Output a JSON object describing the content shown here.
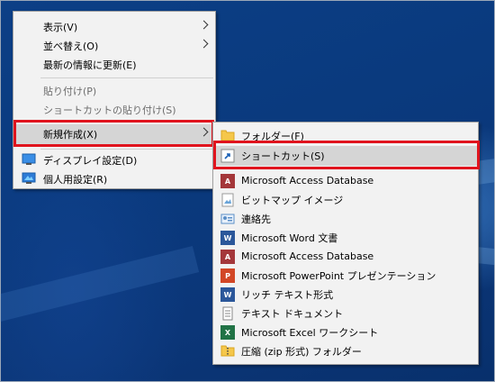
{
  "desktop_menu": {
    "items": [
      {
        "label": "表示(V)",
        "submenu": true,
        "enabled": true
      },
      {
        "label": "並べ替え(O)",
        "submenu": true,
        "enabled": true
      },
      {
        "label": "最新の情報に更新(E)",
        "submenu": false,
        "enabled": true
      },
      {
        "label": "貼り付け(P)",
        "submenu": false,
        "enabled": false
      },
      {
        "label": "ショートカットの貼り付け(S)",
        "submenu": false,
        "enabled": false
      },
      {
        "label": "新規作成(X)",
        "submenu": true,
        "enabled": true,
        "highlighted": true
      },
      {
        "label": "ディスプレイ設定(D)",
        "submenu": false,
        "enabled": true,
        "icon": "display-settings-icon"
      },
      {
        "label": "個人用設定(R)",
        "submenu": false,
        "enabled": true,
        "icon": "personalize-icon"
      }
    ]
  },
  "new_submenu": {
    "items": [
      {
        "label": "フォルダー(F)",
        "icon": "folder-icon"
      },
      {
        "label": "ショートカット(S)",
        "icon": "shortcut-icon",
        "highlighted": true
      },
      {
        "label": "Microsoft Access Database",
        "icon": "access-icon"
      },
      {
        "label": "ビットマップ イメージ",
        "icon": "bitmap-icon"
      },
      {
        "label": "連絡先",
        "icon": "contact-icon"
      },
      {
        "label": "Microsoft Word 文書",
        "icon": "word-icon"
      },
      {
        "label": "Microsoft Access Database",
        "icon": "access-icon"
      },
      {
        "label": "Microsoft PowerPoint プレゼンテーション",
        "icon": "powerpoint-icon"
      },
      {
        "label": "リッチ テキスト形式",
        "icon": "rtf-icon"
      },
      {
        "label": "テキスト ドキュメント",
        "icon": "text-document-icon"
      },
      {
        "label": "Microsoft Excel ワークシート",
        "icon": "excel-icon"
      },
      {
        "label": "圧縮 (zip 形式) フォルダー",
        "icon": "zip-folder-icon"
      }
    ]
  },
  "colors": {
    "highlight_box": "#e0141e",
    "menu_background": "#f2f2f2",
    "hover_background": "#d5d5d5"
  }
}
